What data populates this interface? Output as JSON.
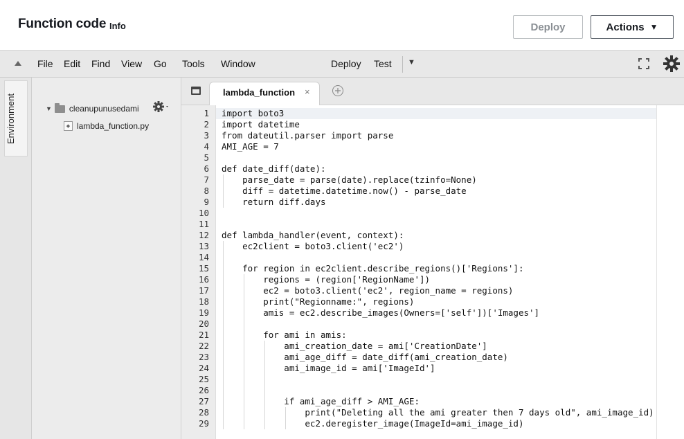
{
  "header": {
    "title": "Function code",
    "info_link": "Info",
    "deploy_button": "Deploy",
    "actions_button": "Actions"
  },
  "menubar": {
    "items": [
      "File",
      "Edit",
      "Find",
      "View",
      "Go",
      "Tools",
      "Window"
    ],
    "deploy": "Deploy",
    "test": "Test"
  },
  "sidebar": {
    "environment_tab": "Environment",
    "folder_name": "cleanupunusedami",
    "file_name": "lambda_function.py"
  },
  "editor": {
    "active_tab": "lambda_function",
    "lines": [
      {
        "n": "1",
        "text": "import boto3",
        "indent": 0
      },
      {
        "n": "2",
        "text": "import datetime",
        "indent": 0
      },
      {
        "n": "3",
        "text": "from dateutil.parser import parse",
        "indent": 0
      },
      {
        "n": "4",
        "text": "AMI_AGE = 7",
        "indent": 0
      },
      {
        "n": "5",
        "text": "",
        "indent": 0
      },
      {
        "n": "6",
        "text": "def date_diff(date):",
        "indent": 0
      },
      {
        "n": "7",
        "text": "    parse_date = parse(date).replace(tzinfo=None)",
        "indent": 1
      },
      {
        "n": "8",
        "text": "    diff = datetime.datetime.now() - parse_date",
        "indent": 1
      },
      {
        "n": "9",
        "text": "    return diff.days",
        "indent": 1
      },
      {
        "n": "10",
        "text": "",
        "indent": 0
      },
      {
        "n": "11",
        "text": "",
        "indent": 0
      },
      {
        "n": "12",
        "text": "def lambda_handler(event, context):",
        "indent": 0
      },
      {
        "n": "13",
        "text": "    ec2client = boto3.client('ec2')",
        "indent": 1
      },
      {
        "n": "14",
        "text": "",
        "indent": 1
      },
      {
        "n": "15",
        "text": "    for region in ec2client.describe_regions()['Regions']:",
        "indent": 1
      },
      {
        "n": "16",
        "text": "        regions = (region['RegionName'])",
        "indent": 2
      },
      {
        "n": "17",
        "text": "        ec2 = boto3.client('ec2', region_name = regions)",
        "indent": 2
      },
      {
        "n": "18",
        "text": "        print(\"Regionname:\", regions)",
        "indent": 2
      },
      {
        "n": "19",
        "text": "        amis = ec2.describe_images(Owners=['self'])['Images']",
        "indent": 2
      },
      {
        "n": "20",
        "text": "",
        "indent": 2
      },
      {
        "n": "21",
        "text": "        for ami in amis:",
        "indent": 2
      },
      {
        "n": "22",
        "text": "            ami_creation_date = ami['CreationDate']",
        "indent": 3
      },
      {
        "n": "23",
        "text": "            ami_age_diff = date_diff(ami_creation_date)",
        "indent": 3
      },
      {
        "n": "24",
        "text": "            ami_image_id = ami['ImageId']",
        "indent": 3
      },
      {
        "n": "25",
        "text": "",
        "indent": 3
      },
      {
        "n": "26",
        "text": "",
        "indent": 3
      },
      {
        "n": "27",
        "text": "            if ami_age_diff > AMI_AGE:",
        "indent": 3
      },
      {
        "n": "28",
        "text": "                print(\"Deleting all the ami greater then 7 days old\", ami_image_id)",
        "indent": 4
      },
      {
        "n": "29",
        "text": "                ec2.deregister_image(ImageId=ami_image_id)",
        "indent": 4
      }
    ]
  }
}
